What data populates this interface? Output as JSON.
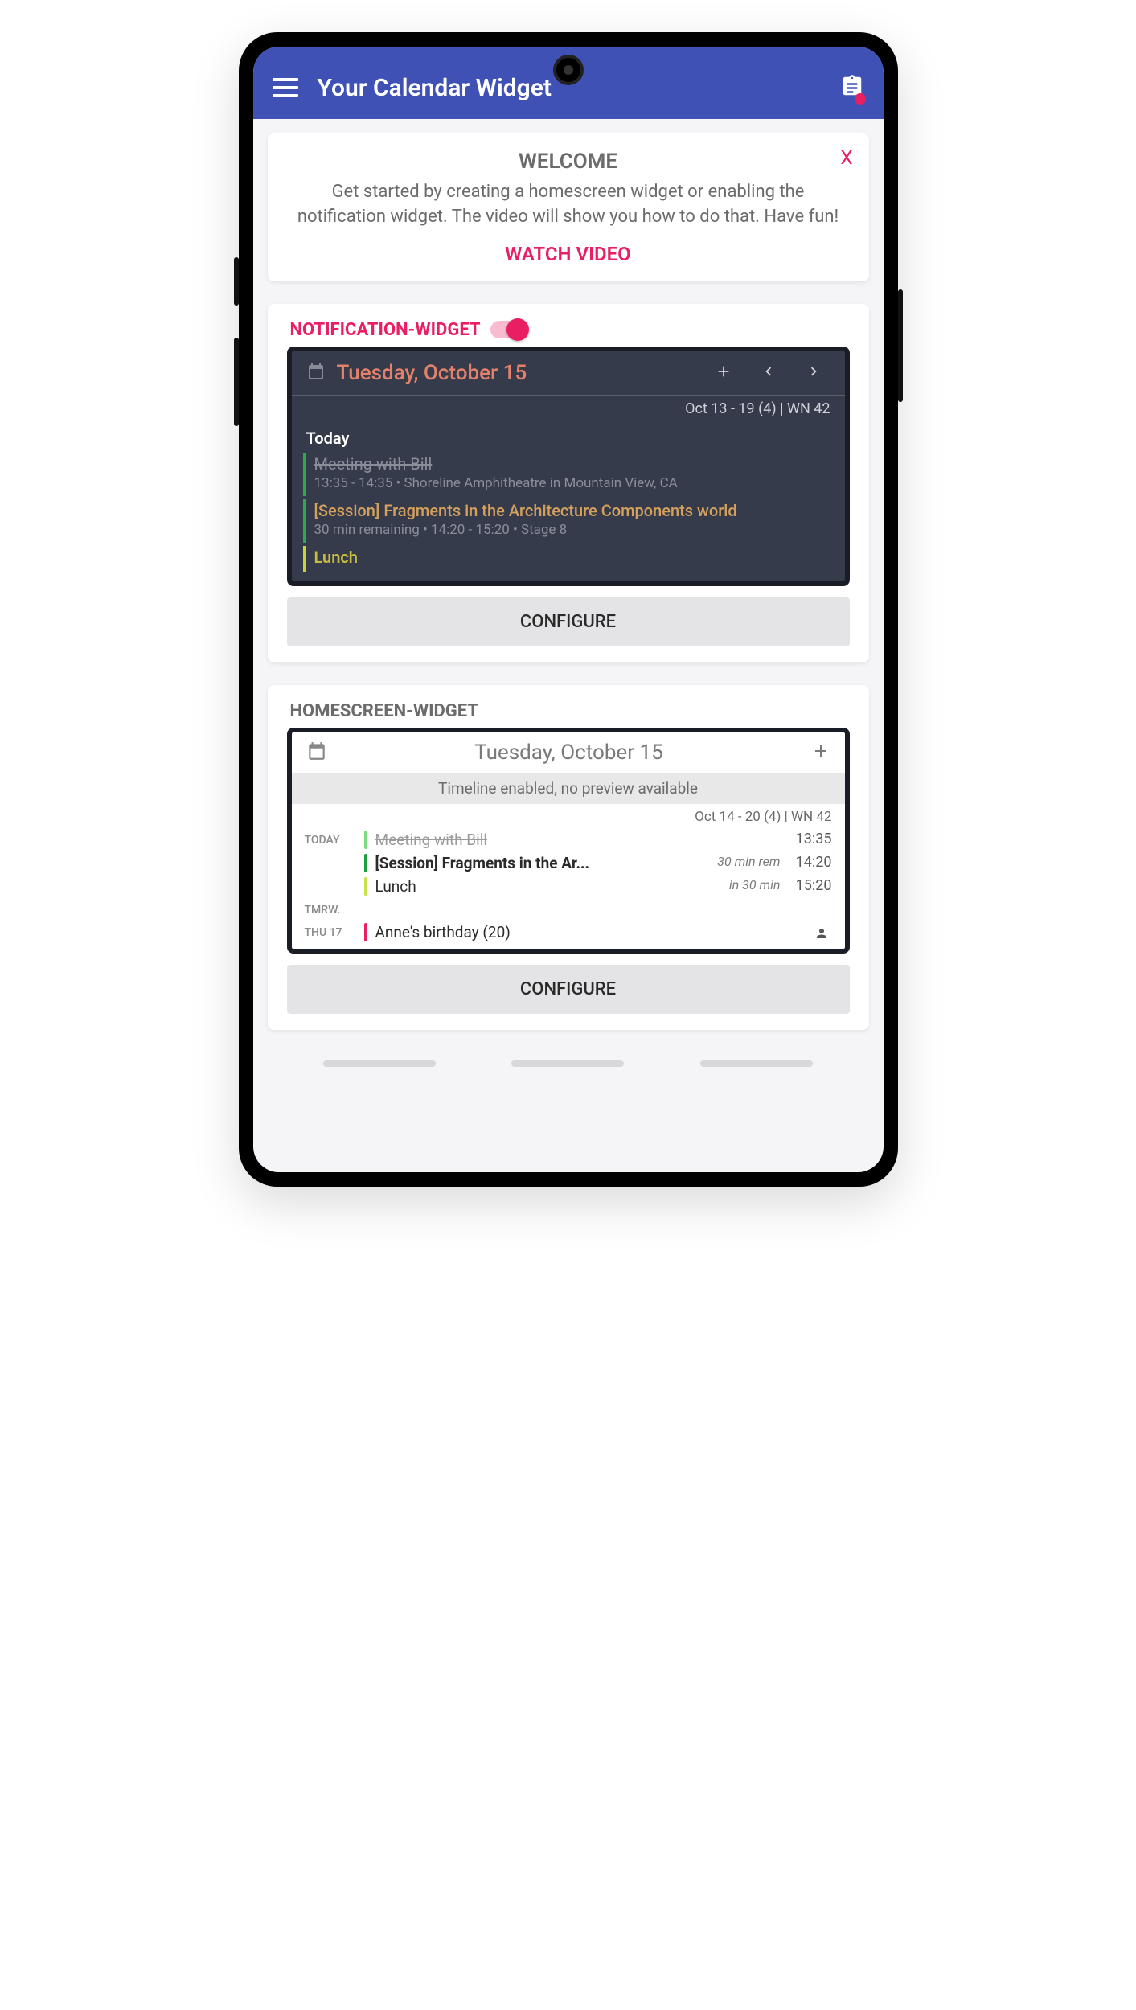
{
  "app": {
    "title": "Your Calendar Widget"
  },
  "welcome": {
    "heading": "WELCOME",
    "body": "Get started by creating a homescreen widget or enabling the notification widget. The video will show you how to do that. Have fun!",
    "cta": "WATCH VIDEO",
    "close": "X"
  },
  "notification_section": {
    "label": "NOTIFICATION-WIDGET",
    "toggle_on": true,
    "widget": {
      "date": "Tuesday, October 15",
      "range": "Oct 13 - 19 (4) | WN 42",
      "today_label": "Today",
      "events": [
        {
          "color": "#2fa84f",
          "title": "Meeting with Bill",
          "struck": true,
          "sub": "13:35 - 14:35   •   Shoreline Amphitheatre in Mountain View, CA"
        },
        {
          "color": "#2fa84f",
          "title": "[Session] Fragments in the Architecture Components world",
          "style": "orange",
          "sub": "30 min remaining   •   14:20 - 15:20   •   Stage 8"
        },
        {
          "color": "#c9d23a",
          "title": "Lunch",
          "style": "yellow",
          "sub": ""
        }
      ]
    },
    "configure": "CONFIGURE"
  },
  "homescreen_section": {
    "label": "HOMESCREEN-WIDGET",
    "widget": {
      "date": "Tuesday, October 15",
      "banner": "Timeline enabled, no preview available",
      "range": "Oct 14 - 20 (4) | WN 42",
      "rows": [
        {
          "day": "TODAY",
          "bar": "#7bdc7b",
          "title": "Meeting with Bill",
          "struck": true,
          "note": "",
          "time": "13:35"
        },
        {
          "day": "",
          "bar": "#1e9e3e",
          "title": "[Session] Fragments in the Ar...",
          "bold": true,
          "note": "30 min rem",
          "time": "14:20"
        },
        {
          "day": "",
          "bar": "#c9e04a",
          "title": "Lunch",
          "note": "in 30 min",
          "time": "15:20"
        },
        {
          "day": "TMRW.",
          "bar": "",
          "title": "",
          "note": "",
          "time": ""
        },
        {
          "day": "THU 17",
          "bar": "#e91e63",
          "title": "Anne's birthday (20)",
          "note": "",
          "time": ""
        }
      ]
    },
    "configure": "CONFIGURE"
  }
}
